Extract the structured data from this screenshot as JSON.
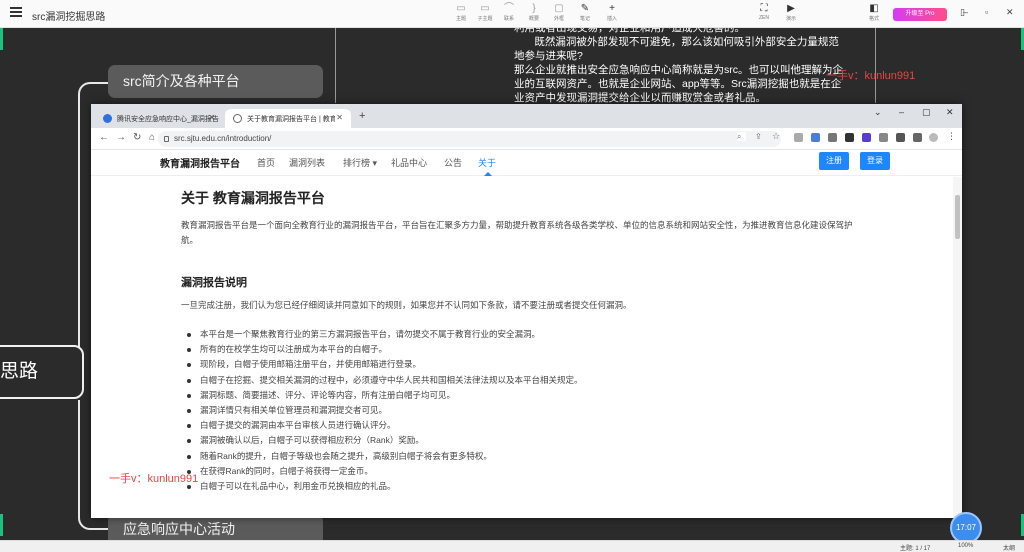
{
  "app": {
    "title": "src漏洞挖掘思路",
    "toolbar": [
      {
        "name": "topic",
        "label": "主题",
        "icon": "▭"
      },
      {
        "name": "subtopic",
        "label": "子主题",
        "icon": "▭"
      },
      {
        "name": "link",
        "label": "联系",
        "icon": "⌒"
      },
      {
        "name": "summary",
        "label": "概要",
        "icon": "}"
      },
      {
        "name": "outline",
        "label": "外框",
        "icon": "▢"
      },
      {
        "name": "note",
        "label": "笔记",
        "icon": "✎"
      },
      {
        "name": "insert",
        "label": "插入",
        "icon": "+"
      },
      {
        "name": "zen",
        "label": "ZEN",
        "icon": "⛶"
      },
      {
        "name": "present",
        "label": "演示",
        "icon": "▶"
      },
      {
        "name": "format",
        "label": "格式",
        "icon": "◧"
      }
    ],
    "pro_label": "升级至 Pro"
  },
  "mindmap": {
    "src_node": "src简介及各种平台",
    "root_node": "思路",
    "emergency_node": "应急响应中心活动",
    "note_lines": [
      "利用或者出现交易，对企业和用户造成大危害的。",
      "       既然漏洞被外部发现不可避免，那么该如何吸引外部安全力量规范",
      "地参与进来呢?",
      "那么企业就推出安全应急响应中心简称就是为src。也可以叫他理解为企",
      "业的互联网资产。也就是企业网站、app等等。Src漏洞挖掘也就是在企",
      "业资产中发现漏洞提交给企业以而赚取赏金或者礼品。"
    ],
    "watermark": "一手v：kunlun991"
  },
  "browser": {
    "tabs": [
      {
        "title": "腾讯安全应急响应中心_漏洞报告",
        "active": false
      },
      {
        "title": "关于教育漏洞报告平台 | 教育漏洞",
        "active": true
      }
    ],
    "url": "src.sjtu.edu.cn/introduction/",
    "site": {
      "brand": "教育漏洞报告平台",
      "nav": [
        "首页",
        "漏洞列表",
        "排行榜 ▾",
        "礼品中心",
        "公告",
        "关于"
      ],
      "active_nav": "关于",
      "register": "注册",
      "login": "登录"
    },
    "page": {
      "title": "关于 教育漏洞报告平台",
      "intro": "教育漏洞报告平台是一个面向全教育行业的漏洞报告平台，平台旨在汇聚多方力量，帮助提升教育系统各级各类学校、单位的信息系统和网站安全性，为推进教育信息化建设保驾护航。",
      "section_title": "漏洞报告说明",
      "lead": "一旦完成注册，我们认为您已经仔细阅读并同意如下的规则，如果您并不认同如下条款，请不要注册或者提交任何漏洞。",
      "rules": [
        "本平台是一个聚焦教育行业的第三方漏洞报告平台，请勿提交不属于教育行业的安全漏洞。",
        "所有的在校学生均可以注册成为本平台的白帽子。",
        "现阶段，白帽子使用邮箱注册平台，并使用邮箱进行登录。",
        "白帽子在挖掘、提交相关漏洞的过程中，必须遵守中华人民共和国相关法律法规以及本平台相关规定。",
        "漏洞标题、简要描述、评分、评论等内容，所有注册白帽子均可见。",
        "漏洞详情只有相关单位管理员和漏洞提交者可见。",
        "白帽子提交的漏洞由本平台审核人员进行确认评分。",
        "漏洞被确认以后，白帽子可以获得相应积分（Rank）奖励。",
        "随着Rank的提升，白帽子等级也会随之提升，高级别白帽子将会有更多特权。",
        "在获得Rank的同时，白帽子将获得一定金币。",
        "白帽子可以在礼品中心，利用金币兑换相应的礼品。"
      ],
      "watermark": "一手v：kunlun991"
    }
  },
  "status": {
    "topic_count": "主题: 1 / 17",
    "zoom": "100%",
    "extra": "太纲"
  },
  "recorder": {
    "time": "17:07"
  }
}
